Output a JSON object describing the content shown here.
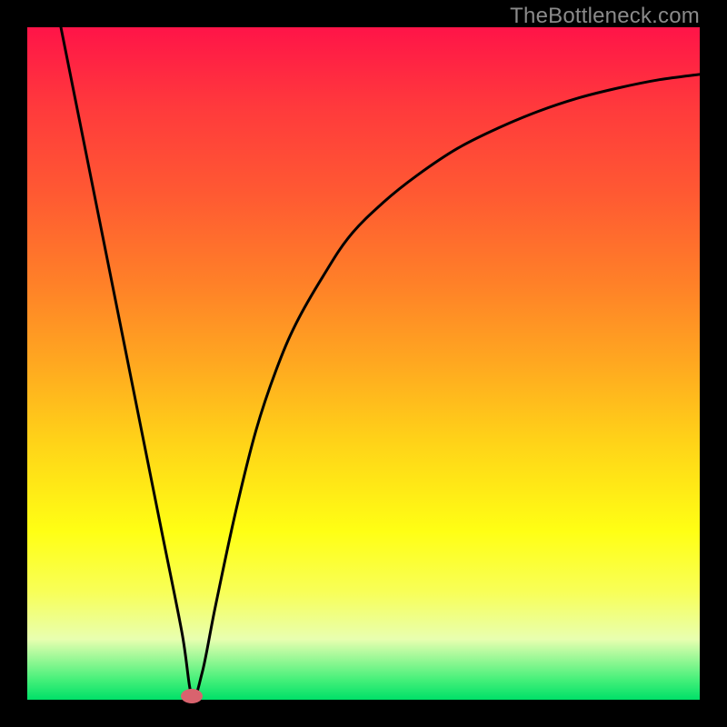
{
  "watermark": "TheBottleneck.com",
  "chart_data": {
    "type": "line",
    "title": "",
    "xlabel": "",
    "ylabel": "",
    "xlim": [
      0,
      100
    ],
    "ylim": [
      0,
      100
    ],
    "grid": false,
    "series": [
      {
        "name": "bottleneck-curve",
        "x": [
          5,
          8,
          11,
          14,
          17,
          20,
          23,
          24.5,
          26,
          28,
          31,
          34,
          37,
          40,
          44,
          48,
          53,
          58,
          64,
          70,
          76,
          82,
          88,
          94,
          100
        ],
        "y": [
          100,
          85,
          70,
          55,
          40,
          25,
          10,
          0.6,
          4,
          14,
          28,
          40,
          49,
          56,
          63,
          69,
          74,
          78,
          82,
          85,
          87.5,
          89.5,
          91,
          92.2,
          93
        ]
      }
    ],
    "annotations": [
      {
        "name": "min-marker",
        "x": 24.5,
        "y": 0.6,
        "color": "#d9636e"
      }
    ],
    "background": {
      "type": "vertical-gradient",
      "stops": [
        {
          "t": 0.0,
          "color": "#ff1448"
        },
        {
          "t": 0.5,
          "color": "#ffa820"
        },
        {
          "t": 0.78,
          "color": "#ffff14"
        },
        {
          "t": 1.0,
          "color": "#00e068"
        }
      ]
    }
  }
}
